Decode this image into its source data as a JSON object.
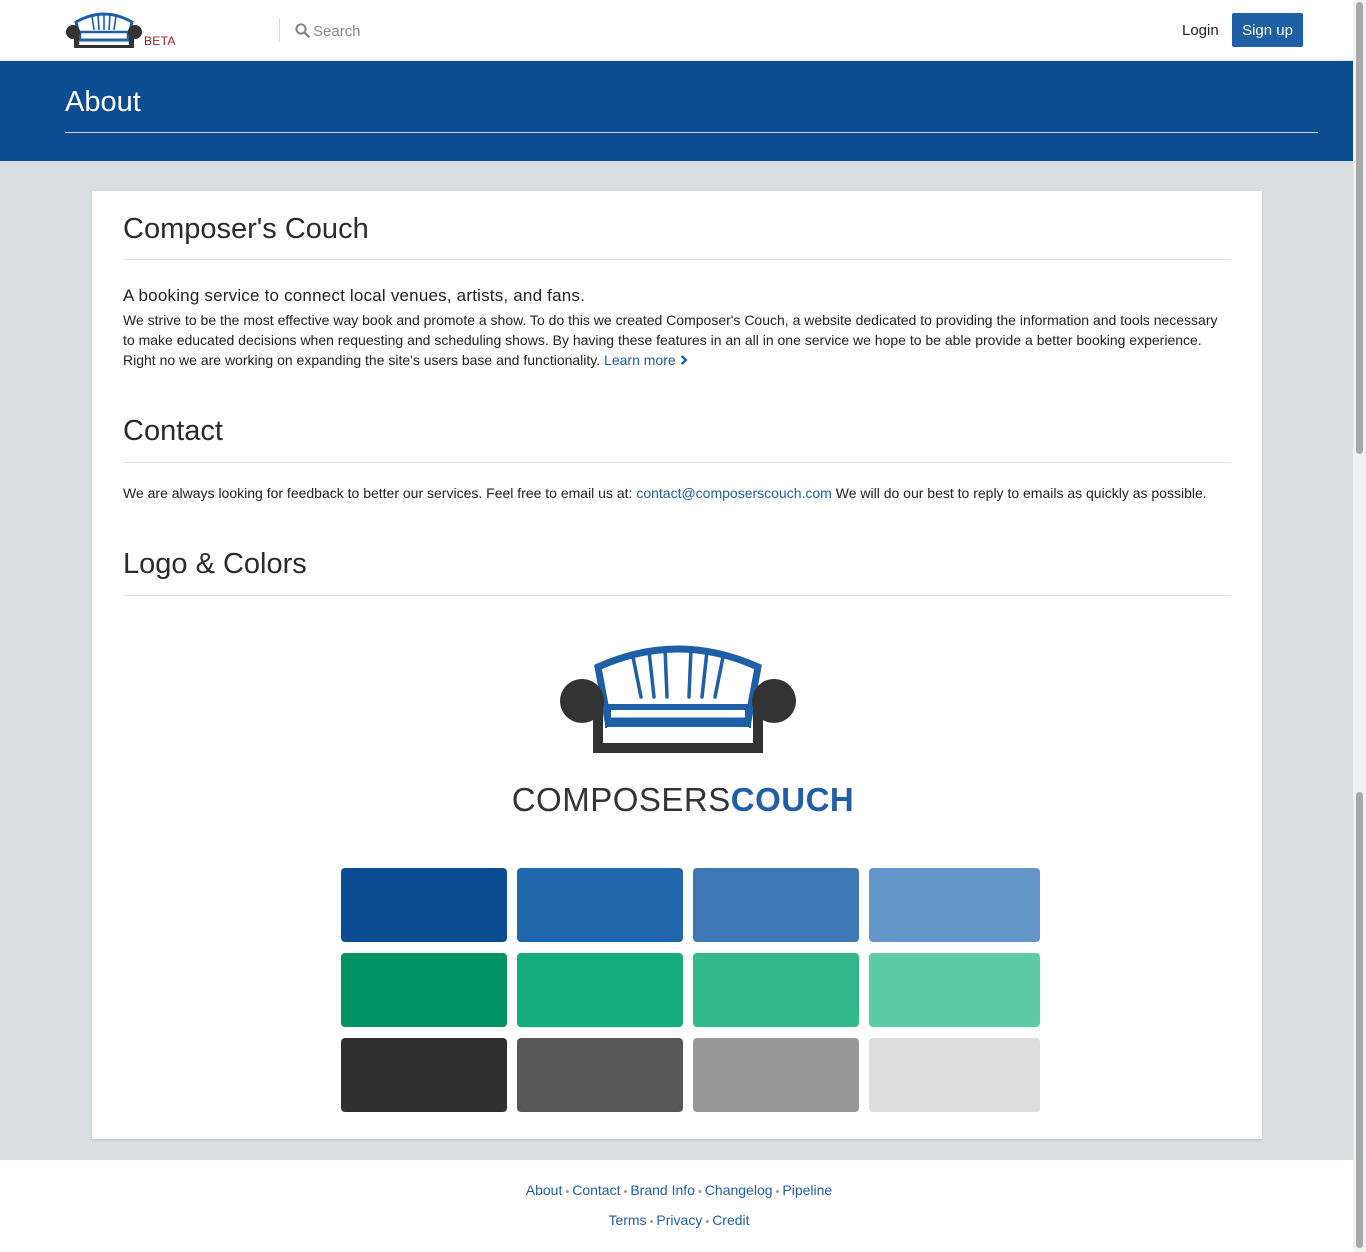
{
  "nav": {
    "beta_label": "BETA",
    "search_placeholder": "Search",
    "login_label": "Login",
    "signup_label": "Sign up"
  },
  "header": {
    "title": "About"
  },
  "sections": {
    "about": {
      "title": "Composer's Couch",
      "tagline": "A booking service to connect local venues, artists, and fans.",
      "body": "We strive to be the most effective way book and promote a show. To do this we created Composer's Couch, a website dedicated to providing the information and tools necessary to make educated decisions when requesting and scheduling shows. By having these features in an all in one service we hope to be able provide a better booking experience. Right no we are working on expanding the site's users base and functionality.",
      "learn_more": "Learn more"
    },
    "contact": {
      "title": "Contact",
      "body_before": "We are always looking for feedback to better our services. Feel free to email us at:",
      "email": "contact@composerscouch.com",
      "body_after": "We will do our best to reply to emails as quickly as possible."
    },
    "logo": {
      "title": "Logo & Colors",
      "wordmark_light": "COMPOSERS",
      "wordmark_bold": "COUCH"
    }
  },
  "palette": [
    [
      "#0c4d91",
      "#2165aa",
      "#3e78b5",
      "#6496c9"
    ],
    [
      "#009465",
      "#16ad7c",
      "#33b88b",
      "#5ccca7"
    ],
    [
      "#303030",
      "#575757",
      "#999999",
      "#dddddd"
    ]
  ],
  "colors": {
    "brand_blue": "#0c4d91",
    "link_blue": "#1f5fa6",
    "beta_red": "#9a1f1f"
  },
  "footer": {
    "row1": [
      "About",
      "Contact",
      "Brand Info",
      "Changelog",
      "Pipeline"
    ],
    "row2": [
      "Terms",
      "Privacy",
      "Credit"
    ]
  }
}
